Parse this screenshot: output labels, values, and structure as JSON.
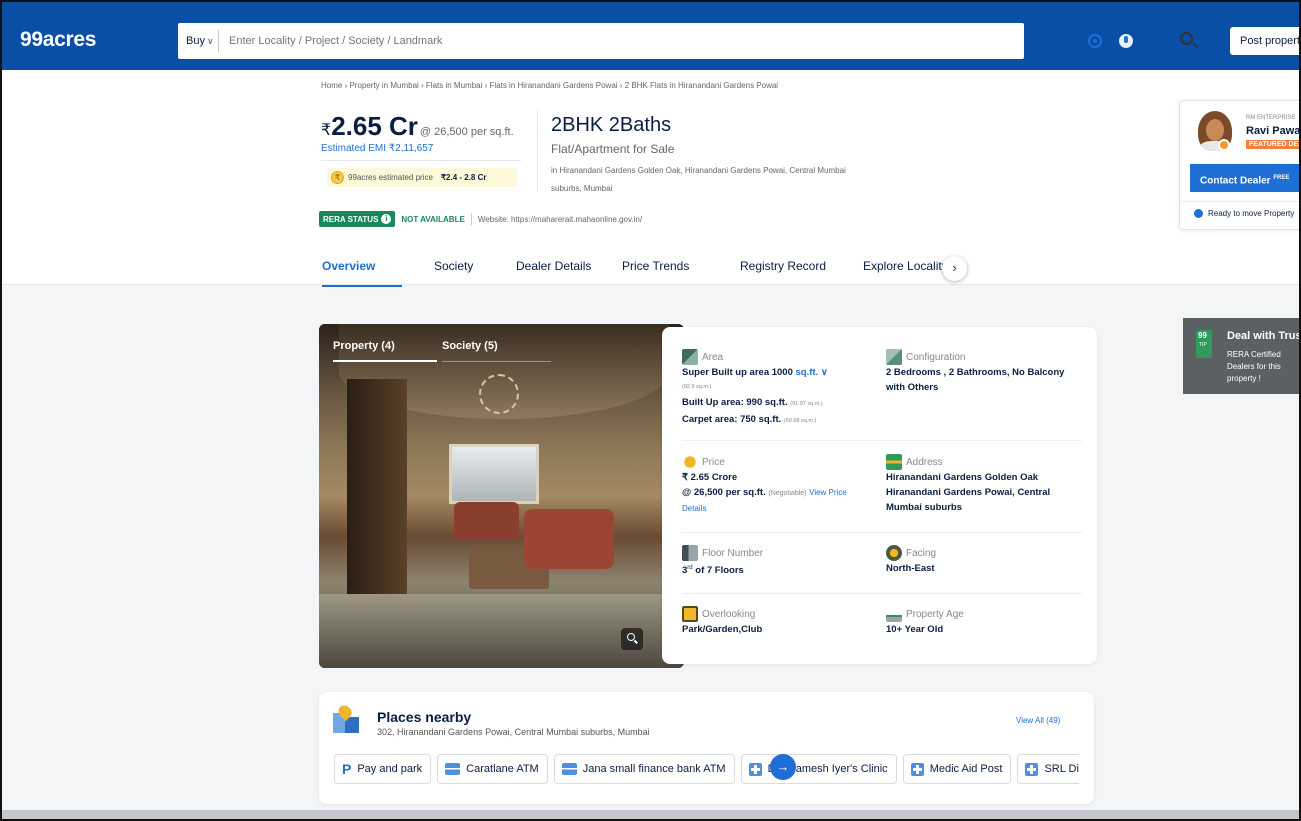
{
  "header": {
    "logo": "99acres",
    "buy_label": "Buy",
    "search_placeholder": "Enter Locality / Project / Society / Landmark",
    "post_property": "Post property"
  },
  "breadcrumb": "Home › Property in Mumbai › Flats in Mumbai › Flats in Hiranandani Gardens Powai › 2 BHK Flats in Hiranandani Gardens Powai",
  "listing": {
    "rupee": "₹",
    "price": "2.65 Cr",
    "per_sqft": "@ 26,500 per sq.ft.",
    "emi": "Estimated EMI ₹2,11,657",
    "est_coin": "₹",
    "est_label": "99acres estimated price",
    "est_range": "₹2.4 - 2.8 Cr",
    "bhk": "2BHK 2Baths",
    "type": "Flat/Apartment for Sale",
    "address": "in Hiranandani Gardens Golden Oak, Hiranandani Gardens Powai, Central Mumbai suburbs, Mumbai"
  },
  "rera": {
    "label": "RERA STATUS",
    "info": "i",
    "status": "NOT AVAILABLE",
    "website": "Website: https://maharerait.mahaonline.gov.in/"
  },
  "tabs": [
    "Overview",
    "Society",
    "Dealer Details",
    "Price Trends",
    "Registry Record",
    "Explore Locality"
  ],
  "tab_next": "›",
  "dealer": {
    "enterprise": "RM ENTERPRISE",
    "name": "Ravi Pawar",
    "badge": "FEATURED DEAL",
    "contact": "Contact Dealer",
    "contact_sup": "FREE",
    "ready": "Ready to move Property"
  },
  "gallery": {
    "tabs": [
      "Property (4)",
      "Society (5)"
    ]
  },
  "details": {
    "area": {
      "label": "Area",
      "line1": "Super Built up area 1000",
      "unit": "sq.ft.",
      "unit_chevron": "∨",
      "sq_m": "(92.9 sq.m.)",
      "builtup": "Built Up area: 990 sq.ft.",
      "builtup_sqm": "(91.97 sq.m.)",
      "carpet": "Carpet area: 750 sq.ft.",
      "carpet_sqm": "(69.68 sq.m.)"
    },
    "configuration": {
      "label": "Configuration",
      "value": "2 Bedrooms , 2 Bathrooms, No Balcony with Others"
    },
    "price": {
      "label": "Price",
      "value": "₹ 2.65 Crore",
      "per_sqft": "@ 26,500 per sq.ft.",
      "negotiable": "(Negotiable)",
      "link": "View Price Details"
    },
    "address": {
      "label": "Address",
      "value": "Hiranandani Gardens Golden Oak Hiranandani Gardens Powai, Central Mumbai suburbs"
    },
    "floor": {
      "label": "Floor Number",
      "num": "3",
      "suffix": "rd",
      "value": "of 7 Floors"
    },
    "facing": {
      "label": "Facing",
      "value": "North-East"
    },
    "overlooking": {
      "label": "Overlooking",
      "value": "Park/Garden,Club"
    },
    "age": {
      "label": "Property Age",
      "value": "10+ Year Old"
    }
  },
  "places": {
    "title": "Places nearby",
    "subtitle": "302, Hiranandani Gardens Powai, Central Mumbai suburbs, Mumbai",
    "view_all": "View All (49)",
    "parking_glyph": "P",
    "chips": [
      "Pay and park",
      "Caratlane ATM",
      "Jana small finance bank ATM",
      "Dr.. Ramesh Iyer's Clinic",
      "Medic Aid Post",
      "SRL Diagnostics"
    ],
    "next": "→"
  },
  "tip": {
    "num": "99",
    "tag": "TIP",
    "title": "Deal with Trusted Dealers",
    "text": "RERA Certified Dealers for this property !"
  }
}
